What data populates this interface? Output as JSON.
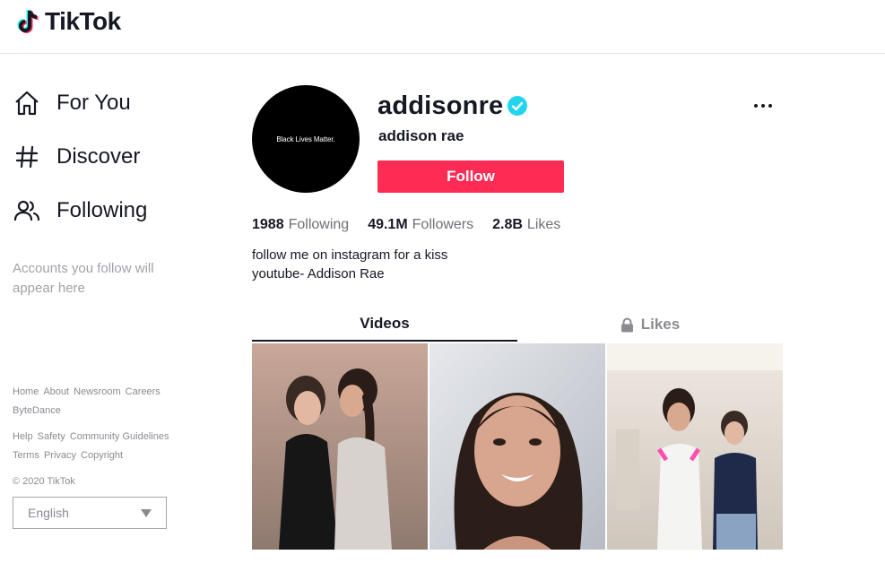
{
  "app": {
    "brand": "TikTok",
    "accent_color": "#fe2c55",
    "verified_color": "#20d5ec"
  },
  "sidebar": {
    "nav": [
      {
        "label": "For You",
        "icon": "home-icon"
      },
      {
        "label": "Discover",
        "icon": "hashtag-icon"
      },
      {
        "label": "Following",
        "icon": "users-icon"
      }
    ],
    "accounts_hint": "Accounts you follow will appear here",
    "footer": {
      "row1": [
        "Home",
        "About",
        "Newsroom",
        "Careers"
      ],
      "row2": [
        "ByteDance"
      ],
      "row3": [
        "Help",
        "Safety",
        "Community Guidelines"
      ],
      "row4": [
        "Terms",
        "Privacy",
        "Copyright"
      ],
      "copyright": "© 2020 TikTok"
    },
    "language": {
      "selected": "English"
    }
  },
  "profile": {
    "avatar_text": "Black Lives Matter.",
    "username": "addisonre",
    "verified": true,
    "display_name": "addison rae",
    "follow_label": "Follow",
    "more_icon": "more-dots-icon",
    "stats": [
      {
        "value": "1988",
        "label": "Following"
      },
      {
        "value": "49.1M",
        "label": "Followers"
      },
      {
        "value": "2.8B",
        "label": "Likes"
      }
    ],
    "bio": [
      "follow me on instagram for a kiss",
      "youtube- Addison Rae"
    ]
  },
  "tabs": [
    {
      "label": "Videos",
      "active": true
    },
    {
      "label": "Likes",
      "active": false,
      "icon": "lock-icon"
    }
  ],
  "videos": [
    {
      "thumbnail": "video-thumbnail-1"
    },
    {
      "thumbnail": "video-thumbnail-2"
    },
    {
      "thumbnail": "video-thumbnail-3"
    }
  ]
}
